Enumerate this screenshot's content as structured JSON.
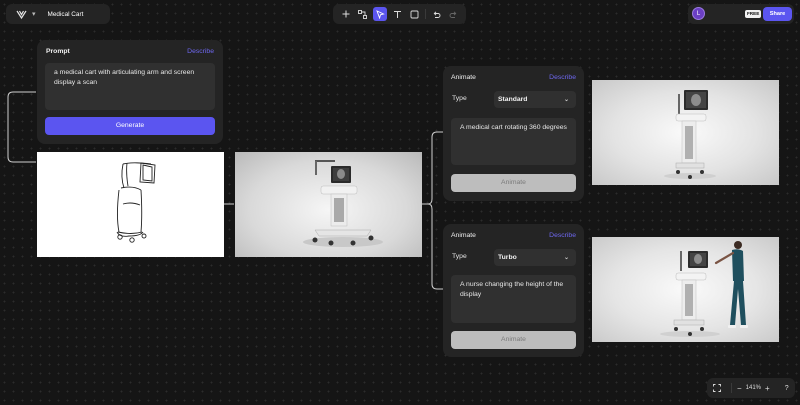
{
  "header": {
    "project_title": "Medical Cart"
  },
  "account": {
    "avatar_initial": "L",
    "plan_badge": "FREE",
    "share_label": "Share"
  },
  "prompt_panel": {
    "title": "Prompt",
    "describe_link": "Describe",
    "text": "a medical cart with articulating arm and screen display a scan",
    "generate_label": "Generate"
  },
  "animate_panels": [
    {
      "title": "Animate",
      "describe_link": "Describe",
      "type_label": "Type",
      "type_value": "Standard",
      "text": "A medical cart rotating 360 degrees",
      "button_label": "Animate"
    },
    {
      "title": "Animate",
      "describe_link": "Describe",
      "type_label": "Type",
      "type_value": "Turbo",
      "text": "A nurse changing the height of the display",
      "button_label": "Animate"
    }
  ],
  "zoom": {
    "level": "141%",
    "help": "?"
  },
  "colors": {
    "accent": "#5b55f0",
    "panel": "#242424",
    "canvas": "#151515"
  }
}
